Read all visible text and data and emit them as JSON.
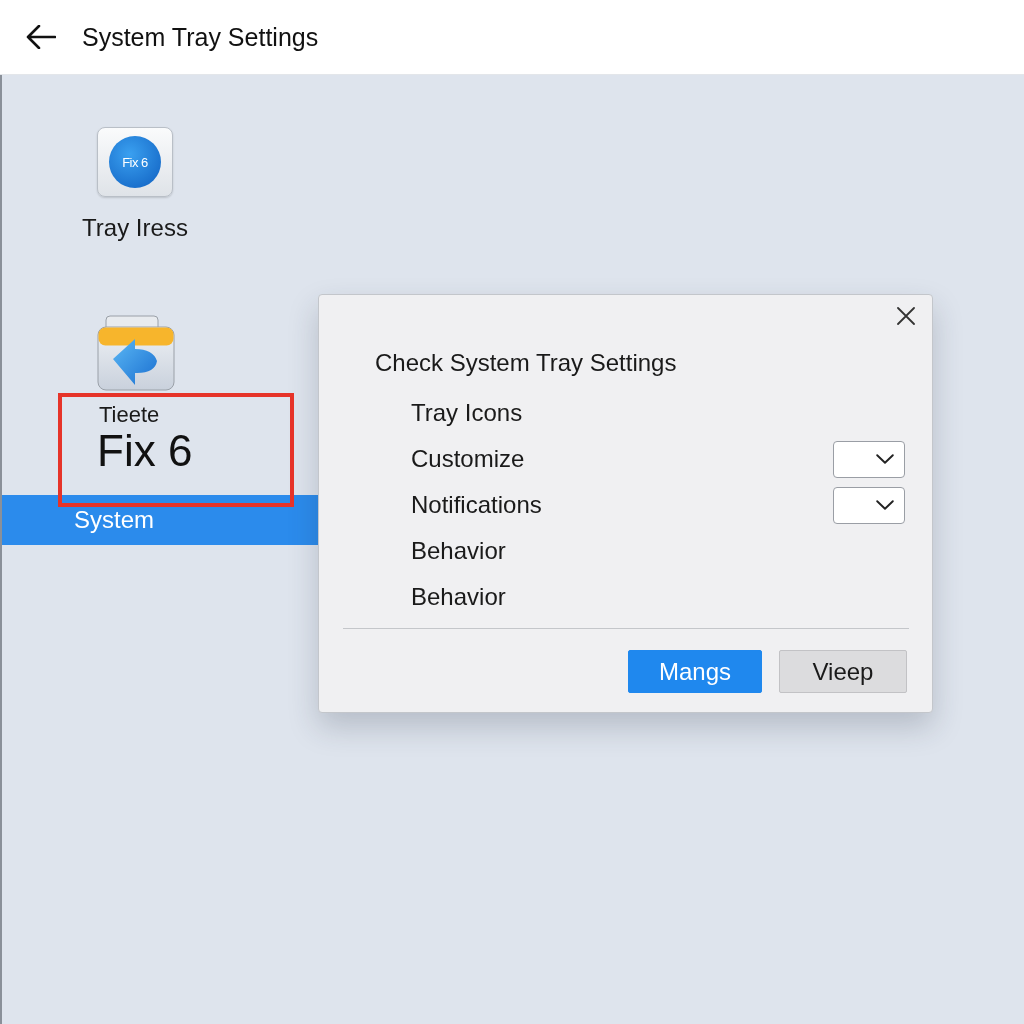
{
  "header": {
    "title": "System Tray Settings"
  },
  "desktop_icons": [
    {
      "kind": "app",
      "icon_text": "Fix 6",
      "label": "Tray Iress",
      "highlighted": false
    },
    {
      "kind": "folder",
      "label": "Tieete",
      "big_label": "Fix 6",
      "highlighted": true
    }
  ],
  "sidebar": {
    "items": [
      {
        "label": "System",
        "selected": true
      }
    ]
  },
  "dialog": {
    "title": "Check System Tray Settings",
    "rows": [
      {
        "kind": "text",
        "label": "Tray Icons"
      },
      {
        "kind": "dropdown",
        "label": "Customize"
      },
      {
        "kind": "dropdown",
        "label": "Notifications"
      },
      {
        "kind": "text",
        "label": "Behavior"
      },
      {
        "kind": "text",
        "label": "Behavior"
      }
    ],
    "buttons": [
      {
        "label": "Mangs",
        "primary": true
      },
      {
        "label": "Vieep",
        "primary": false
      }
    ]
  }
}
